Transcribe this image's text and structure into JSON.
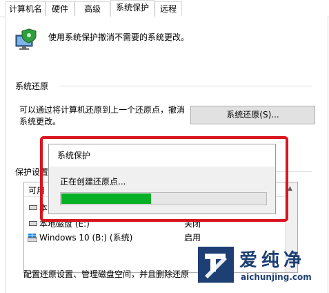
{
  "tabs": [
    {
      "label": "计算机名"
    },
    {
      "label": "硬件"
    },
    {
      "label": "高级"
    },
    {
      "label": "系统保护"
    },
    {
      "label": "远程"
    }
  ],
  "active_tab": "系统保护",
  "description": "使用系统保护撤消不需要的系统更改。",
  "restore_section": {
    "title": "系统还原",
    "text": "可以通过将计算机还原到上一个还原点，撤消系统更改。",
    "button": "系统还原(S)..."
  },
  "protection_section": {
    "title": "保护设置",
    "column_header": "可用"
  },
  "drives": [
    {
      "name": "本",
      "status": ""
    },
    {
      "name": "本地磁盘 (E:)",
      "status": "关闭"
    },
    {
      "name": "Windows 10 (B:) (系统)",
      "status": "启用"
    }
  ],
  "bottom_text": "配置还原设置、管理磁盘空间，并且删除还原",
  "dialog": {
    "title": "系统保护",
    "message": "正在创建还原点...",
    "progress": 0.44
  },
  "watermark": {
    "title": "爱纯净",
    "url": "aichunjing.com"
  },
  "colors": {
    "progress_fill": "#06b025",
    "highlight_border": "#d8161f",
    "watermark": "#1d3f73"
  }
}
